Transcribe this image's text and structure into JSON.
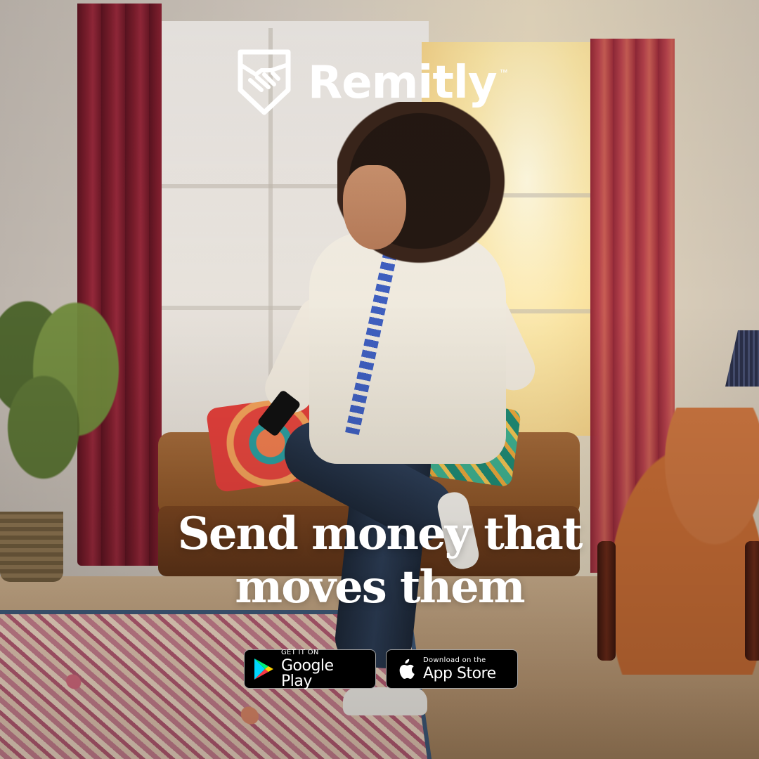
{
  "brand": {
    "name": "Remitly",
    "trademark": "™",
    "logo_icon": "handshake-shield-icon"
  },
  "headline": {
    "line1": "Send money that",
    "line2": "moves them"
  },
  "store_badges": {
    "google_play": {
      "small_text": "GET IT ON",
      "big_text": "Google Play",
      "icon": "google-play-icon"
    },
    "app_store": {
      "small_text": "Download on the",
      "big_text": "App Store",
      "icon": "apple-icon"
    }
  },
  "colors": {
    "headline_text": "#ffffff",
    "logo": "#ffffff",
    "badge_background": "#000000"
  }
}
